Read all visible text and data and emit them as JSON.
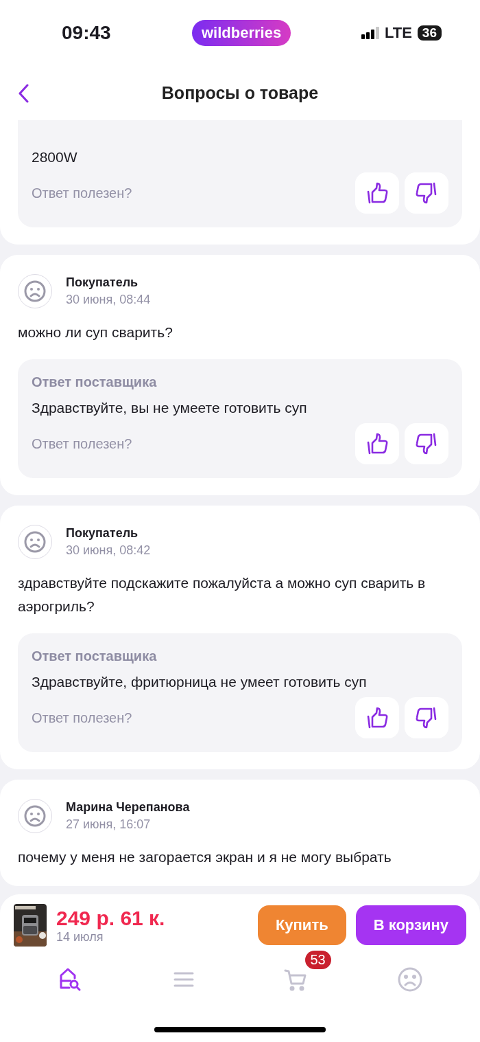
{
  "status_bar": {
    "time": "09:43",
    "brand": "wildberries",
    "network": "LTE",
    "battery": "36"
  },
  "header": {
    "title": "Вопросы о товаре"
  },
  "questions": [
    {
      "answer": {
        "text": "2800W"
      },
      "helpful_prompt": "Ответ полезен?"
    },
    {
      "author": "Покупатель",
      "date": "30 июня, 08:44",
      "text": "можно ли суп сварить?",
      "answer": {
        "label": "Ответ поставщика",
        "text": "Здравствуйте, вы не умеете готовить суп"
      },
      "helpful_prompt": "Ответ полезен?"
    },
    {
      "author": "Покупатель",
      "date": "30 июня, 08:42",
      "text": "здравствуйте подскажите пожалуйста а можно суп сварить в аэрогриль?",
      "answer": {
        "label": "Ответ поставщика",
        "text": "Здравствуйте, фритюрница не умеет готовить суп"
      },
      "helpful_prompt": "Ответ полезен?"
    },
    {
      "author": "Марина Черепанова",
      "date": "27 июня, 16:07",
      "text": "почему у меня не загорается экран и я не могу выбрать"
    }
  ],
  "product_bar": {
    "price": "249 р. 61 к.",
    "delivery": "14 июля",
    "buttons": [
      {
        "label": "Купить",
        "kind": "buy"
      },
      {
        "label": "В корзину",
        "kind": "cart"
      }
    ]
  },
  "tab_bar": [
    {
      "kind": "home",
      "selected": true
    },
    {
      "kind": "catalog",
      "selected": false
    },
    {
      "kind": "cart",
      "selected": false,
      "badge": "53"
    },
    {
      "kind": "profile",
      "selected": false
    }
  ]
}
